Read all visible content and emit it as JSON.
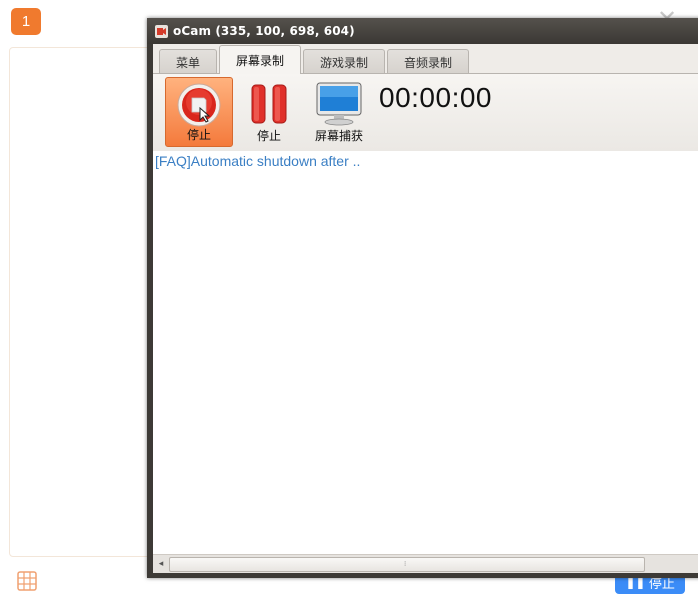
{
  "background_app": {
    "badge_number": "1",
    "stop_button_label": "停止",
    "colors": {
      "accent_orange": "#f07a2e",
      "accent_blue": "#3b8cf7"
    }
  },
  "ocam": {
    "title": "oCam (335, 100, 698, 604)",
    "tabs": [
      {
        "label": "菜单",
        "active": false
      },
      {
        "label": "屏幕录制",
        "active": true
      },
      {
        "label": "游戏录制",
        "active": false
      },
      {
        "label": "音频录制",
        "active": false
      }
    ],
    "toolbar": {
      "record_stop_label": "停止",
      "pause_label": "停止",
      "capture_label": "屏幕捕获",
      "timer": "00:00:00"
    },
    "faq_link": "[FAQ]Automatic shutdown after .."
  }
}
